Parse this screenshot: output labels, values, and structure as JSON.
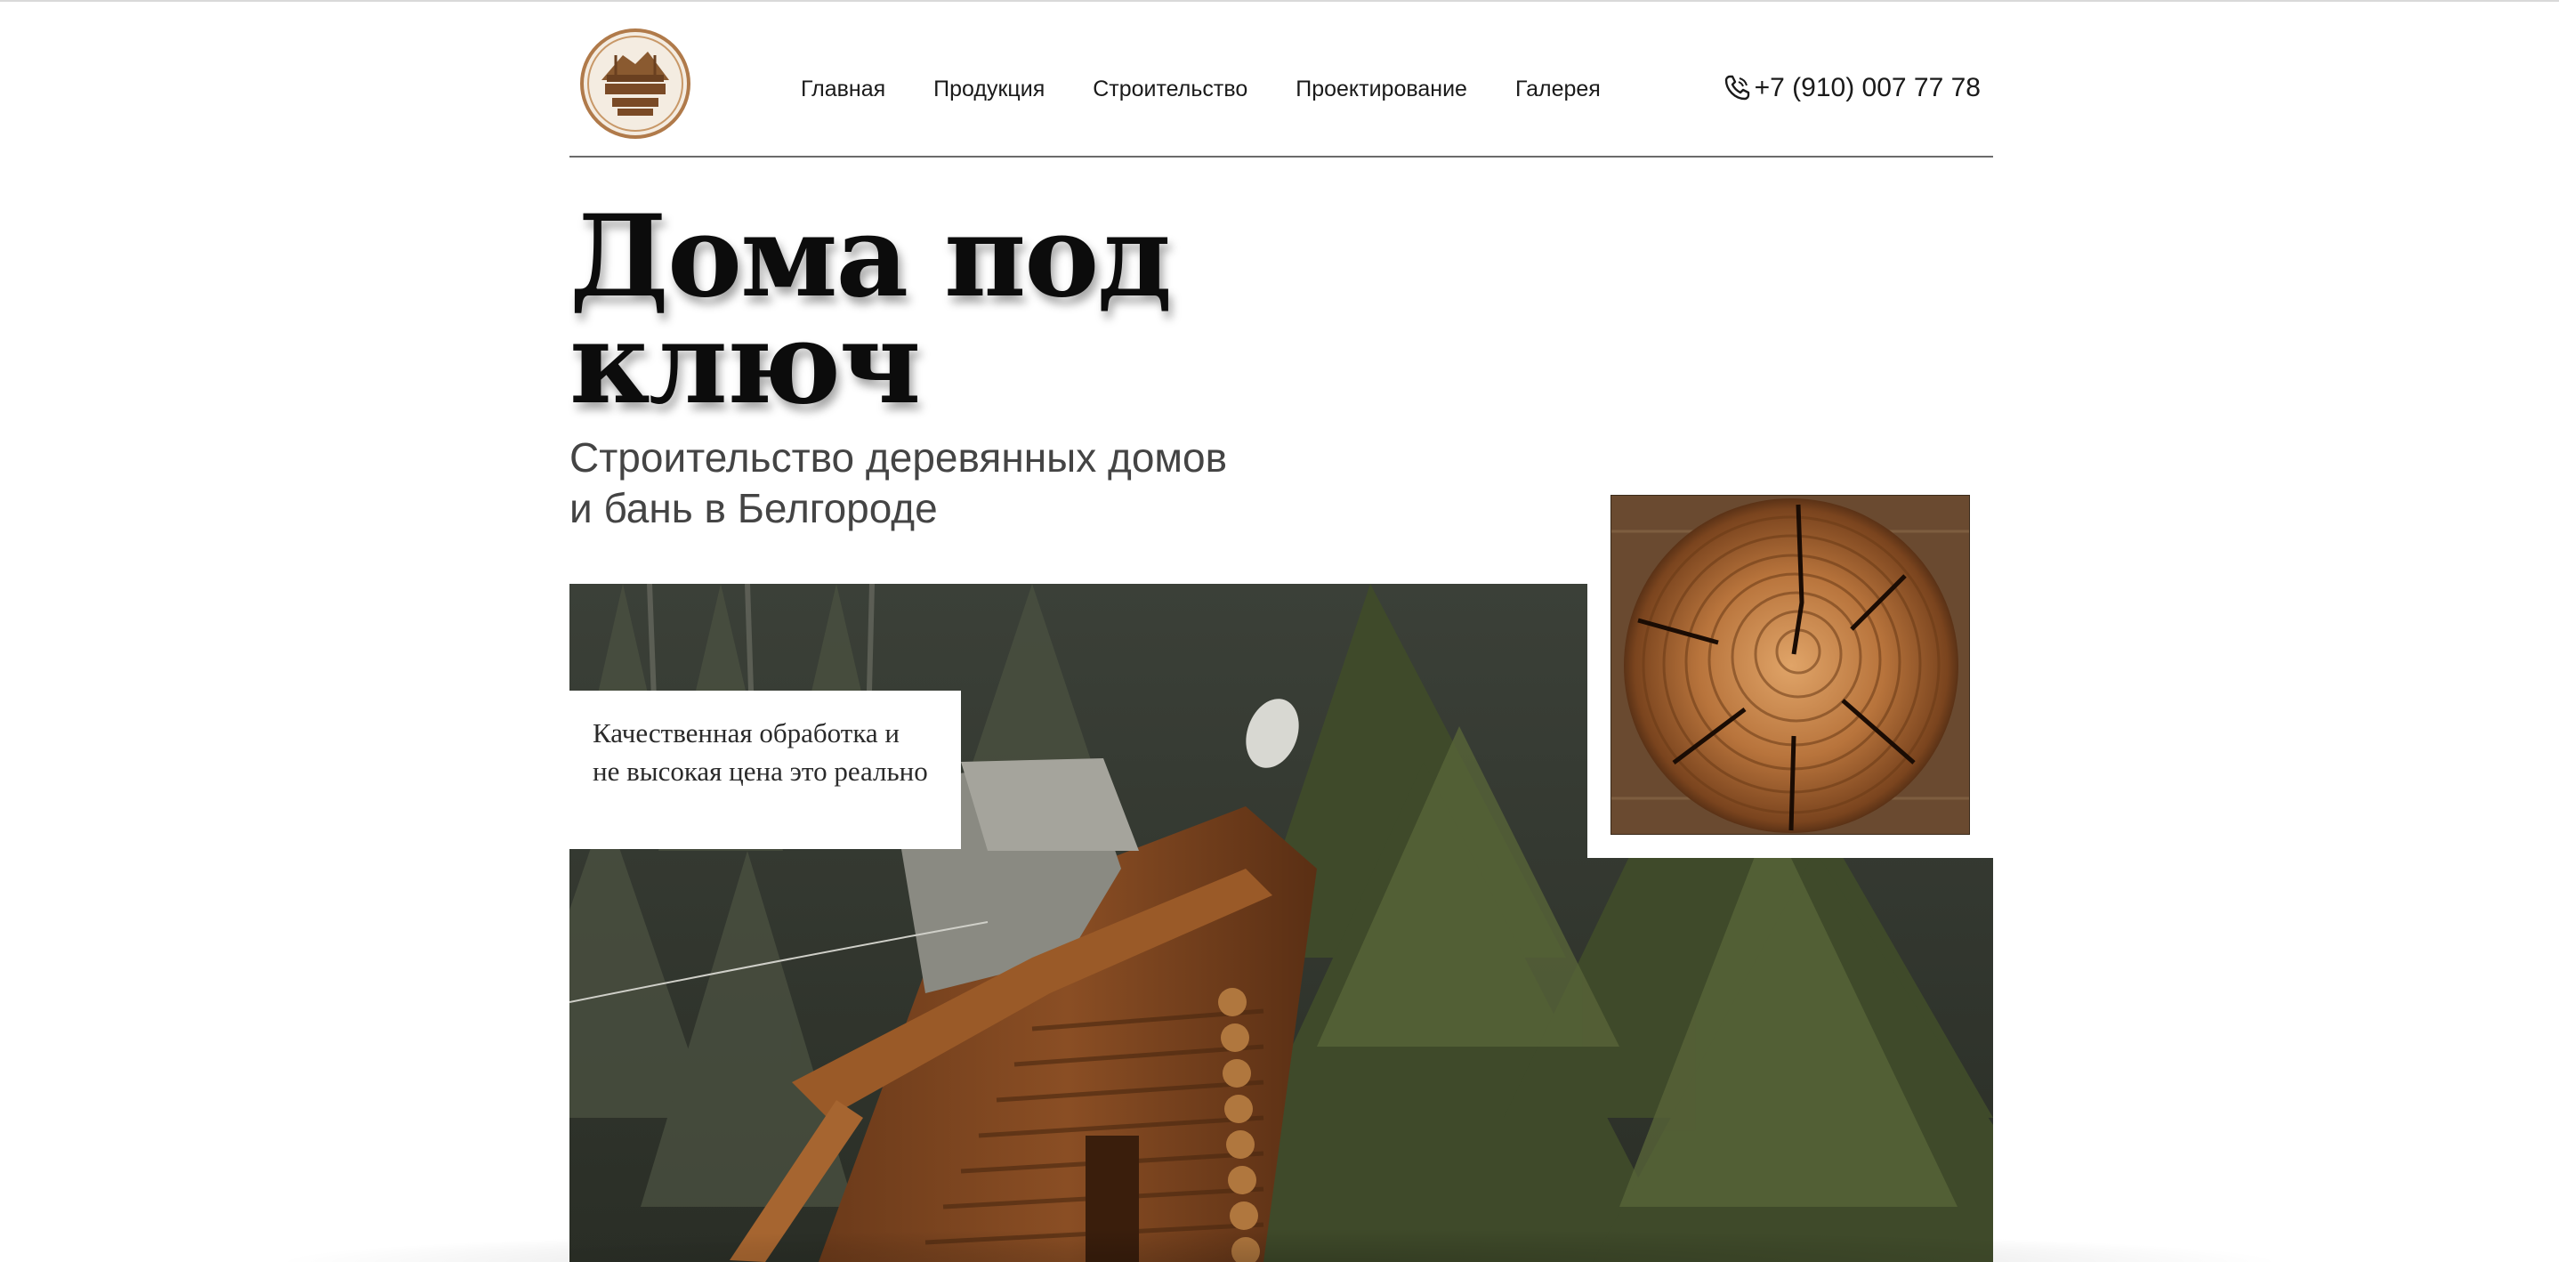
{
  "header": {
    "logo_alt": "Плотницкая изба",
    "nav": [
      {
        "label": "Главная"
      },
      {
        "label": "Продукция"
      },
      {
        "label": "Строительство"
      },
      {
        "label": "Проектирование"
      },
      {
        "label": "Галерея"
      }
    ],
    "phone": "+7 (910) 007 77 78",
    "phone_icon": "phone-icon"
  },
  "hero": {
    "title_line1": "Дома под",
    "title_line2": "ключ",
    "subtitle_line1": "Строительство деревянных домов",
    "subtitle_line2": "и бань в Белгороде"
  },
  "caption": {
    "line1": "Качественная обработка и",
    "line2": "не высокая цена это реально"
  },
  "colors": {
    "text": "#1a1a1a",
    "subtitle": "#444444",
    "rule": "#6b6b6b",
    "logo_ring": "#b07a4a"
  }
}
